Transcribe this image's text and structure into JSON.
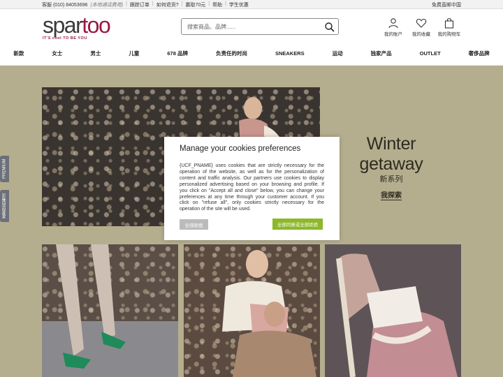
{
  "topbar": {
    "service": "客服 (010) 84053696",
    "service_note": "(本地通话费用)",
    "track_order": "跟踪订单",
    "how_return": "如何退货?",
    "coupon": "赢取70元",
    "help": "帮助",
    "student": "学生优惠",
    "shipping": "免费直邮中国"
  },
  "logo": {
    "part1": "spar",
    "part2": "too",
    "tagline": "IT'S cool TO BE YOU"
  },
  "search": {
    "placeholder": "搜索商品、品牌......"
  },
  "header_icons": {
    "account": "我的账户",
    "favorites": "我的收藏",
    "cart": "我的购物车"
  },
  "nav": [
    "新款",
    "女士",
    "男士",
    "儿童",
    "678 品牌",
    "负责任的时尚",
    "SNEAKERS",
    "运动",
    "独家产品",
    "OUTLET",
    "奢侈品牌"
  ],
  "hero": {
    "title": "Winter getaway",
    "subtitle": "新系列",
    "cta": "我探索"
  },
  "side_tabs": {
    "premium": "PREMIUM",
    "opinion": "发表您的看法"
  },
  "cookie": {
    "title": "Manage your cookies preferences",
    "body": "{UCF_PNAME} uses cookies that are strictly necessary for the operation of the website, as well as for the personalization of content and traffic analysis. Our partners use cookies to display personalized advertising based on your browsing and profile. If you click on \"Accept all and close\" below, you can change your preferences at any time through your customer account. If you click on \"refuse all\", only cookies strictly necessary for the operation of the site will be used.",
    "refuse": "全部拒绝",
    "accept": "全部同意或全部拒绝"
  },
  "colors": {
    "brand": "#9b1a43",
    "accept_button": "#8cb82a",
    "overlay": "#b5ae8e"
  }
}
